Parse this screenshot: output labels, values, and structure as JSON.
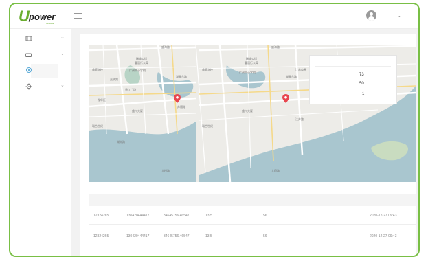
{
  "brand": {
    "logo_letter": "U",
    "logo_word": "power",
    "logo_sub": "MOBILE",
    "accent_color": "#79bf45"
  },
  "header": {
    "menu_icon": "hamburger-icon",
    "avatar_icon": "user-avatar-icon",
    "dropdown_icon": "chevron-down-icon"
  },
  "sidebar": {
    "items": [
      {
        "icon": "film-icon",
        "expandable": true
      },
      {
        "icon": "battery-icon",
        "expandable": true
      },
      {
        "icon": "location-icon",
        "expandable": false,
        "active": true
      },
      {
        "icon": "settings-icon",
        "expandable": true
      }
    ]
  },
  "map": {
    "labels_left": [
      "盛海路",
      "瑞雄公馆",
      "富丽行公寓",
      "盛庭学校",
      "广州中心学校",
      "光明路",
      "湖景东路",
      "香江广场",
      "龙华区",
      "苏通路",
      "盛州大厦",
      "瑞合世纪",
      "湖南路",
      "大桥路"
    ],
    "labels_right": [
      "盛海路",
      "瑞雄公馆",
      "富丽行公寓",
      "盛庭学校",
      "江苏商圈",
      "广州中心学校",
      "湖景东路",
      "盛州大厦",
      "江苏路",
      "瑞合世纪",
      "大桥路"
    ],
    "marker_color": "#e8464f"
  },
  "info_panel": {
    "values": [
      "73",
      "50",
      "1"
    ]
  },
  "table": {
    "rows": [
      {
        "id": "12324265",
        "code": "130420444417",
        "serial": "34645756.46547",
        "a": "13:5",
        "b": "56",
        "time": "2020-12-27 09:43"
      },
      {
        "id": "12324265",
        "code": "130420444417",
        "serial": "34645756.46547",
        "a": "13:5",
        "b": "56",
        "time": "2020-12-27 09:43"
      }
    ]
  }
}
